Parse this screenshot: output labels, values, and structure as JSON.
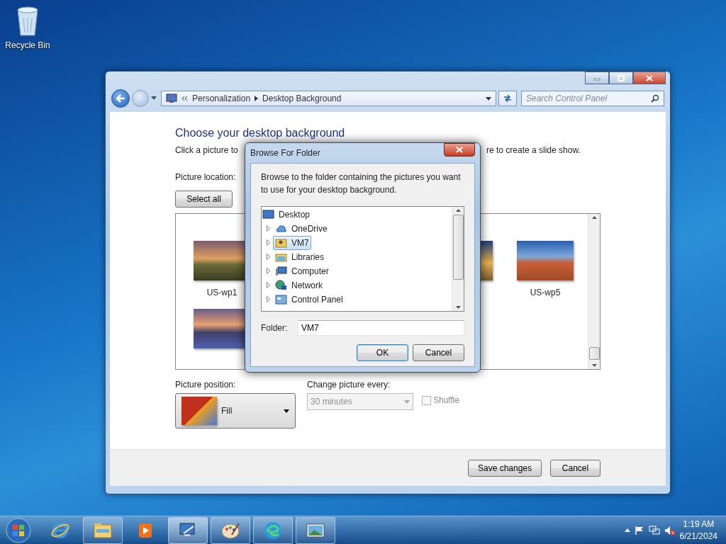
{
  "desktop_icons": [
    {
      "label": "Recycle Bin"
    }
  ],
  "window": {
    "breadcrumbs": [
      "Personalization",
      "Desktop Background"
    ],
    "search": {
      "placeholder": "Search Control Panel"
    },
    "heading": "Choose your desktop background",
    "description_parts": [
      "Click a picture to",
      "re to create a slide show."
    ],
    "picture_location_label": "Picture location:",
    "select_all": "Select all",
    "thumbnails": [
      {
        "label": "US-wp1"
      },
      {
        "label": "US-wp5"
      }
    ],
    "picture_position": {
      "label": "Picture position:",
      "value": "Fill"
    },
    "change_picture": {
      "label": "Change picture every:",
      "value": "30 minutes",
      "disabled": true
    },
    "shuffle": {
      "label": "Shuffle",
      "checked": false,
      "disabled": true
    },
    "footer_buttons": [
      "Save changes",
      "Cancel"
    ]
  },
  "dialog": {
    "title": "Browse For Folder",
    "instructions": "Browse to the folder containing the pictures you want to use for your desktop background.",
    "tree": [
      {
        "label": "Desktop",
        "kind": "desktop",
        "children": [
          {
            "label": "OneDrive",
            "kind": "cloud",
            "selected": false
          },
          {
            "label": "VM7",
            "kind": "user",
            "selected": true
          },
          {
            "label": "Libraries",
            "kind": "library",
            "selected": false
          },
          {
            "label": "Computer",
            "kind": "computer",
            "selected": false
          },
          {
            "label": "Network",
            "kind": "network",
            "selected": false
          },
          {
            "label": "Control Panel",
            "kind": "panel",
            "selected": false
          }
        ]
      }
    ],
    "folder_label": "Folder:",
    "folder_value": "VM7",
    "buttons": [
      {
        "label": "OK",
        "default": true
      },
      {
        "label": "Cancel",
        "default": false
      }
    ]
  },
  "taskbar": {
    "items": [
      {
        "kind": "ie",
        "running": false,
        "selected": false
      },
      {
        "kind": "explorer",
        "running": true,
        "selected": false
      },
      {
        "kind": "media",
        "running": false,
        "selected": false
      },
      {
        "kind": "panel",
        "running": true,
        "selected": true
      },
      {
        "kind": "paint",
        "running": true,
        "selected": false
      },
      {
        "kind": "edge",
        "running": true,
        "selected": false
      },
      {
        "kind": "photos",
        "running": true,
        "selected": false
      }
    ],
    "time": "1:19 AM",
    "date": "6/21/2024"
  }
}
